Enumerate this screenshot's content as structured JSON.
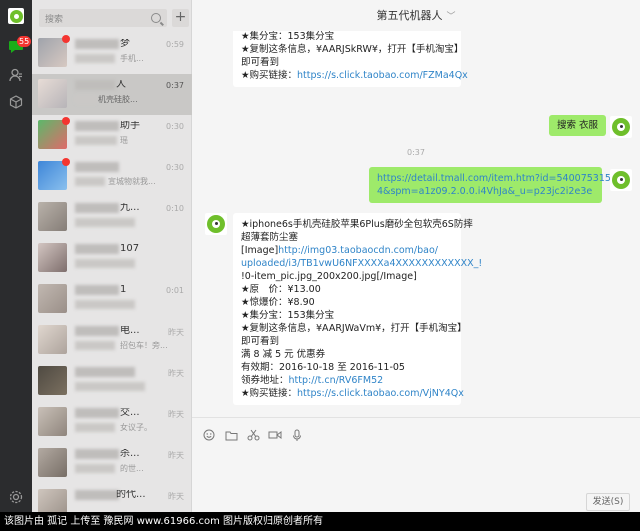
{
  "sidebar": {
    "unread_badge": "55"
  },
  "search": {
    "placeholder": "搜索",
    "add_label": "+"
  },
  "conversations": [
    {
      "name": "梦",
      "preview": "手机...",
      "time": "0:59"
    },
    {
      "name": "人",
      "preview": "机壳硅胶...",
      "time": "0:37"
    },
    {
      "name": "助手",
      "preview": "瑶",
      "time": "0:30"
    },
    {
      "name": "",
      "preview": "宣城物就我...",
      "time": "0:30"
    },
    {
      "name": "九...",
      "preview": "",
      "time": "0:10"
    },
    {
      "name": "107",
      "preview": "",
      "time": ""
    },
    {
      "name": "1",
      "preview": "",
      "time": "0:01"
    },
    {
      "name": "电...",
      "preview": "招包车！旁...",
      "time": "昨天"
    },
    {
      "name": "",
      "preview": "",
      "time": "昨天"
    },
    {
      "name": "交...",
      "preview": "女议子。",
      "time": "昨天"
    },
    {
      "name": "杀...",
      "preview": "的世...",
      "time": "昨天"
    },
    {
      "name": "的代...",
      "preview": "",
      "time": "昨天"
    }
  ],
  "chat": {
    "title": "第五代机器人",
    "messages": {
      "m1": {
        "lines": [
          "★集分宝：153集分宝",
          "★复制这条信息，¥AARJSkRW¥，打开【手机淘宝】",
          "即可看到"
        ],
        "buy_label": "★购买链接：",
        "buy_link": "https://s.click.taobao.com/FZMa4Qx"
      },
      "m2": {
        "text": "搜索 衣服"
      },
      "time1": "0:37",
      "m3": {
        "line1": "https://detail.tmall.com/item.htm?id=54007531545",
        "line2": "4&spm=a1z09.2.0.0.i4VhJa&_u=p23jc2i2e3e"
      },
      "m4": {
        "title1": "★iphone6s手机壳硅胶苹果6Plus磨砂全包软壳6S防摔",
        "title2": "超薄套防尘塞",
        "img_prefix": "[Image]",
        "img_link1": "http://img03.taobaocdn.com/bao/",
        "img_link2": "uploaded/i3/TB1vwU6NFXXXXa4XXXXXXXXXXXX_!",
        "img_suffix": "!0-item_pic.jpg_200x200.jpg[/Image]",
        "price": "★原　价：¥13.00",
        "promo": "★惊爆价：¥8.90",
        "points": "★集分宝：153集分宝",
        "copy1": "★复制这条信息，¥AARJWaVm¥，打开【手机淘宝】",
        "copy2": "即可看到",
        "coupon": "满 8 减 5 元 优惠券",
        "valid": "有效期：2016-10-18 至 2016-11-05",
        "coupon_label": "领券地址：",
        "coupon_link": "http://t.cn/RV6FM52",
        "buy_label": "★购买链接：",
        "buy_link": "https://s.click.taobao.com/VjNY4Qx"
      }
    }
  },
  "composer": {
    "send_label": "发送(S)"
  },
  "footer": {
    "text": "该图片由 孤记 上传至 豫民网 www.61966.com 图片版权归原创者所有"
  },
  "colors": {
    "sent_bubble": "#9eea6a",
    "link": "#2f84c8",
    "rail": "#2b2c2e",
    "brand": "#1aad19"
  }
}
